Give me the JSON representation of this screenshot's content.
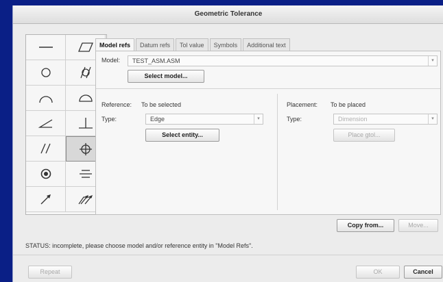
{
  "dialog": {
    "title": "Geometric Tolerance"
  },
  "palette": {
    "icons": [
      "straightness-icon",
      "flatness-icon",
      "circularity-icon",
      "cylindricity-icon",
      "line-profile-icon",
      "surface-profile-icon",
      "angularity-icon",
      "perpendicularity-icon",
      "parallelism-icon",
      "position-icon",
      "concentricity-icon",
      "symmetry-icon",
      "circular-runout-icon",
      "total-runout-icon"
    ],
    "selected": "position-icon"
  },
  "tabs": [
    "Model refs",
    "Datum refs",
    "Tol value",
    "Symbols",
    "Additional text"
  ],
  "model": {
    "label": "Model:",
    "value": "TEST_ASM.ASM",
    "select_button": "Select model..."
  },
  "reference": {
    "label": "Reference:",
    "status": "To be selected",
    "type_label": "Type:",
    "type_value": "Edge",
    "select_button": "Select entity..."
  },
  "placement": {
    "label": "Placement:",
    "status": "To be placed",
    "type_label": "Type:",
    "type_value": "Dimension",
    "place_button": "Place gtol..."
  },
  "actions": {
    "copy_from": "Copy from...",
    "move": "Move..."
  },
  "status_text": "STATUS: incomplete, please choose model and/or reference entity in \"Model Refs\".",
  "footer": {
    "repeat": "Repeat",
    "ok": "OK",
    "cancel": "Cancel"
  }
}
